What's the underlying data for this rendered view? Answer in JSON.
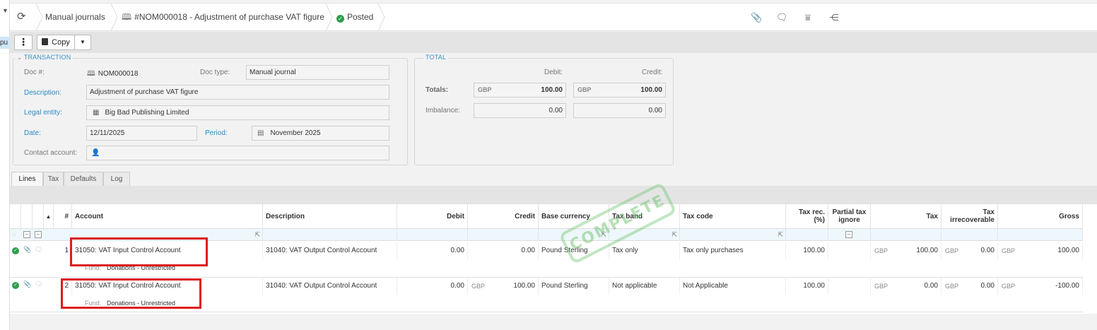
{
  "header": {
    "breadcrumb_journals": "Manual journals",
    "breadcrumb_doc": "#NOM000018 - Adjustment of purchase VAT figure",
    "status": "Posted",
    "left_strip_text": "pu"
  },
  "toolbar": {
    "copy_label": "Copy"
  },
  "transaction": {
    "legend": "TRANSACTION",
    "doc_no_label": "Doc #:",
    "doc_no_value": "NOM000018",
    "doc_type_label": "Doc type:",
    "doc_type_value": "Manual journal",
    "description_label": "Description:",
    "description_value": "Adjustment of purchase VAT figure",
    "legal_entity_label": "Legal entity:",
    "legal_entity_value": "Big Bad Publishing Limited",
    "date_label": "Date:",
    "date_value": "12/11/2025",
    "period_label": "Period:",
    "period_value": "November 2025",
    "contact_label": "Contact account:"
  },
  "total": {
    "legend": "TOTAL",
    "debit_label": "Debit:",
    "credit_label": "Credit:",
    "totals_label": "Totals:",
    "imbalance_label": "Imbalance:",
    "currency": "GBP",
    "debit_total": "100.00",
    "credit_total": "100.00",
    "debit_imbalance": "0.00",
    "credit_imbalance": "0.00"
  },
  "tabs": [
    "Lines",
    "Tax",
    "Defaults",
    "Log"
  ],
  "grid": {
    "headers": {
      "sort": "▲",
      "num": "#",
      "account": "Account",
      "description": "Description",
      "debit": "Debit",
      "credit": "Credit",
      "base_currency": "Base currency",
      "tax_band": "Tax band",
      "tax_code": "Tax code",
      "tax_rec": "Tax rec. (%)",
      "partial_tax": "Partial tax ignore",
      "tax": "Tax",
      "tax_irrecoverable": "Tax irrecoverable",
      "gross": "Gross"
    },
    "fund_label": "Fund:",
    "rows": [
      {
        "num": "1",
        "account": "31050: VAT Input Control Account",
        "description": "31040: VAT Output Control Account",
        "debit": "0.00",
        "credit_cur": "",
        "credit": "0.00",
        "base_currency": "Pound Sterling",
        "tax_band": "Tax only",
        "tax_code": "Tax only purchases",
        "tax_rec": "100.00",
        "tax_cur": "GBP",
        "tax": "100.00",
        "irr_cur": "GBP",
        "tax_irrecoverable": "0.00",
        "gross_cur": "GBP",
        "gross": "100.00",
        "fund": "Donations - Unrestricted"
      },
      {
        "num": "2",
        "account": "31050: VAT Input Control Account",
        "description": "31040: VAT Output Control Account",
        "debit": "0.00",
        "credit_cur": "GBP",
        "credit": "100.00",
        "base_currency": "Pound Sterling",
        "tax_band": "Not applicable",
        "tax_code": "Not Applicable",
        "tax_rec": "100.00",
        "tax_cur": "GBP",
        "tax": "0.00",
        "irr_cur": "GBP",
        "tax_irrecoverable": "0.00",
        "gross_cur": "GBP",
        "gross": "-100.00",
        "fund": "Donations - Unrestricted"
      }
    ]
  },
  "stamp_text": "COMPLETE",
  "colors": {
    "accent_link": "#2c8ac6",
    "posted_green": "#2e9e4f",
    "highlight_red": "#dd1c1c"
  }
}
